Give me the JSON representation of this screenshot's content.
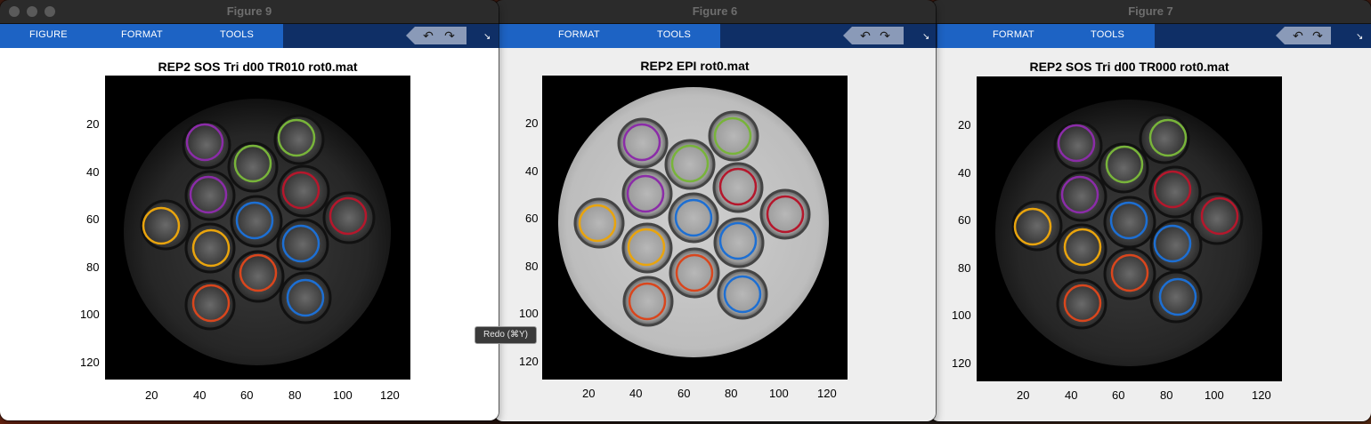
{
  "desktop": {
    "background": "#3a1a10"
  },
  "windows": [
    {
      "title": "Figure 9",
      "menu": [
        "FIGURE",
        "FORMAT",
        "TOOLS"
      ],
      "axes_title": "REP2 SOS Tri d00 TR010 rot0.mat",
      "y_ticks": [
        "20",
        "40",
        "60",
        "80",
        "100",
        "120"
      ],
      "x_ticks": [
        "20",
        "40",
        "60",
        "80",
        "100",
        "120"
      ],
      "image_type": "dark",
      "body_bg": "#ffffff"
    },
    {
      "title": "Figure 6",
      "menu": [
        "FORMAT",
        "TOOLS"
      ],
      "axes_title": "REP2 EPI rot0.mat",
      "y_ticks": [
        "20",
        "40",
        "60",
        "80",
        "100",
        "120"
      ],
      "x_ticks": [
        "20",
        "40",
        "60",
        "80",
        "100",
        "120"
      ],
      "image_type": "bright",
      "body_bg": "#eeeeee"
    },
    {
      "title": "Figure 7",
      "menu": [
        "FORMAT",
        "TOOLS"
      ],
      "axes_title": "REP2 SOS Tri d00 TR000 rot0.mat",
      "y_ticks": [
        "20",
        "40",
        "60",
        "80",
        "100",
        "120"
      ],
      "x_ticks": [
        "20",
        "40",
        "60",
        "80",
        "100",
        "120"
      ],
      "image_type": "dark",
      "body_bg": "#eeeeee"
    }
  ],
  "toolbar_icons": {
    "undo": "undo-arrow-icon",
    "redo": "redo-arrow-icon",
    "dock": "dock-arrow-icon"
  },
  "tooltip": "Redo (⌘Y)",
  "roi_colors": {
    "purple": "#8b2ca8",
    "green": "#78b43a",
    "red": "#b5172c",
    "orange": "#e9a40d",
    "blue": "#1d6fd3",
    "redorange": "#d9461d"
  }
}
